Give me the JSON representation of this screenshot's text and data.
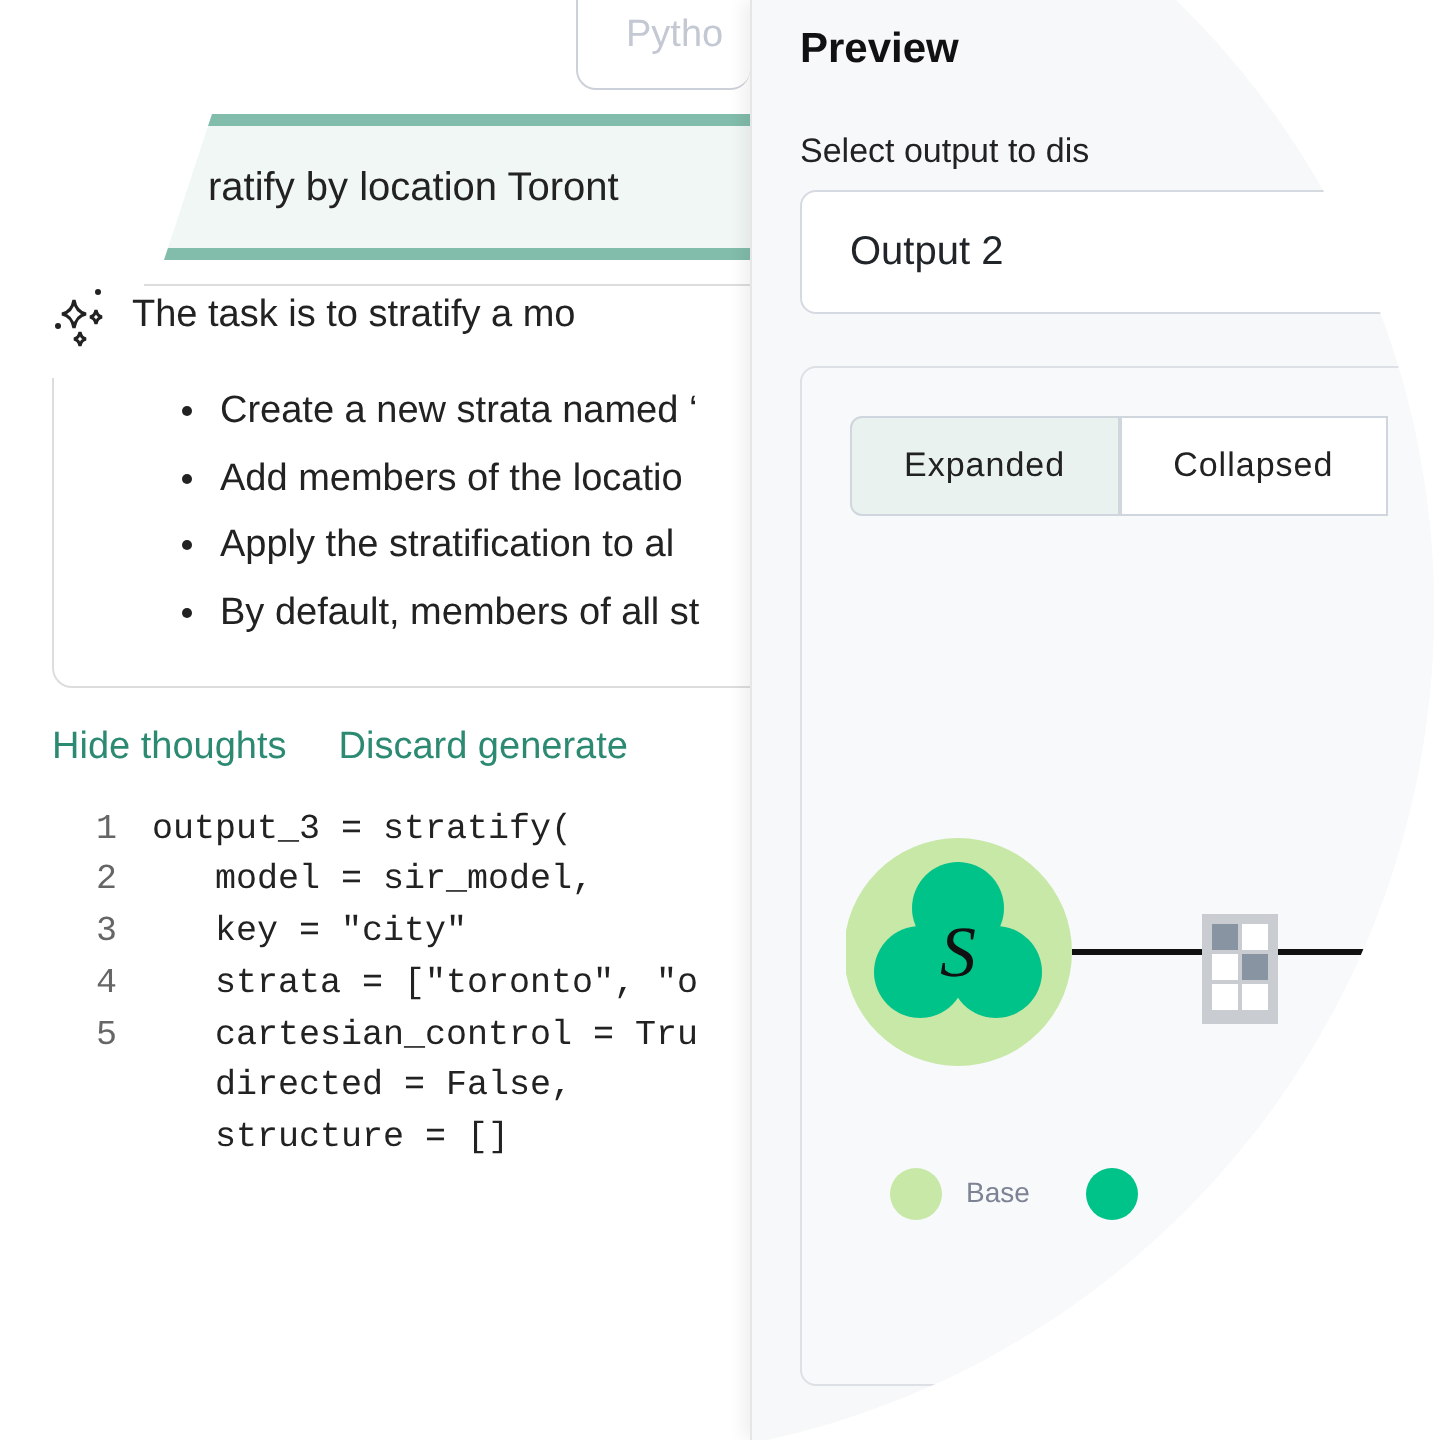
{
  "left": {
    "language_button": "Pytho",
    "prompt": "ratify by location Toront",
    "thoughts": {
      "summary": "The task is to stratify a mo",
      "bullets": [
        "Create a new strata named ‘",
        "Add members of the locatio",
        "Apply the stratification to al",
        "By default, members of all st"
      ]
    },
    "links": [
      "Hide thoughts",
      "Discard generate"
    ],
    "code": [
      {
        "number": "1",
        "text": "output_3 = stratify("
      },
      {
        "number": "2",
        "text": "   model = sir_model,"
      },
      {
        "number": "3",
        "text": "   key = \"city\""
      },
      {
        "number": "4",
        "text": "   strata = [\"toronto\", \"o"
      },
      {
        "number": "5",
        "text": "   cartesian_control = Tru"
      },
      {
        "text": "   directed = False,"
      },
      {
        "text": "   structure = []"
      }
    ]
  },
  "preview": {
    "title": "Preview",
    "select_label": "Select output to dis",
    "select_value": "Output 2",
    "tabs": [
      {
        "label": "Expanded",
        "selected": true
      },
      {
        "label": "Collapsed",
        "selected": false
      }
    ],
    "node": {
      "label": "S"
    },
    "legend": [
      {
        "label": "Base",
        "color": "#c8e8a8"
      },
      {
        "color": "#00c389"
      }
    ]
  }
}
